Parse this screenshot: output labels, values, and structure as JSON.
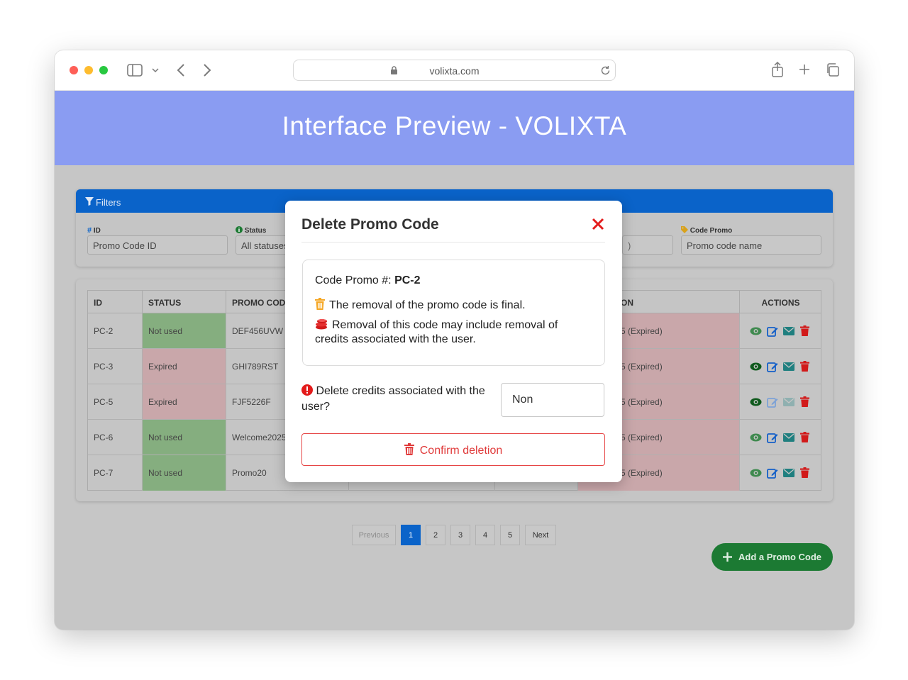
{
  "browser": {
    "url": "volixta.com"
  },
  "app": {
    "title": "Interface Preview - VOLIXTA"
  },
  "filters": {
    "title": "Filters",
    "id_label": "ID",
    "id_placeholder": "Promo Code ID",
    "status_label": "Status",
    "status_value": "All statuses",
    "code_label": "Code Promo",
    "code_placeholder": "Promo code name"
  },
  "table": {
    "headers": {
      "id": "ID",
      "status": "STATUS",
      "promo": "PROMO CODE",
      "expiration_partial": "ON",
      "actions": "ACTIONS"
    },
    "rows": [
      {
        "id": "PC-2",
        "status": "Not used",
        "status_color": "green",
        "code": "DEF456UVW",
        "expiry": "5 (Expired)",
        "view_active": false,
        "edit_active": true,
        "mail_active": true
      },
      {
        "id": "PC-3",
        "status": "Expired",
        "status_color": "red",
        "code": "GHI789RST",
        "expiry": "5 (Expired)",
        "view_active": true,
        "edit_active": true,
        "mail_active": true
      },
      {
        "id": "PC-5",
        "status": "Expired",
        "status_color": "red",
        "code": "FJF5226F",
        "expiry": "5 (Expired)",
        "view_active": true,
        "edit_active": false,
        "mail_active": false
      },
      {
        "id": "PC-6",
        "status": "Not used",
        "status_color": "green",
        "code": "Welcome2025",
        "expiry": "5 (Expired)",
        "view_active": false,
        "edit_active": true,
        "mail_active": true
      },
      {
        "id": "PC-7",
        "status": "Not used",
        "status_color": "green",
        "code": "Promo20",
        "expiry": "5 (Expired)",
        "view_active": false,
        "edit_active": true,
        "mail_active": true
      }
    ]
  },
  "pagination": {
    "previous": "Previous",
    "pages": [
      "1",
      "2",
      "3",
      "4",
      "5"
    ],
    "next": "Next",
    "active_page": "1"
  },
  "add_button": {
    "label": "Add a Promo Code"
  },
  "modal": {
    "title": "Delete Promo Code",
    "code_prefix": "Code Promo #: ",
    "code_value": "PC-2",
    "line1": "The removal of the promo code is final.",
    "line2a": "Removal of this code may include removal of",
    "line2b": "credits associated with the user.",
    "question": "Delete credits associated with the user?",
    "select_value": "Non",
    "confirm_label": "Confirm deletion"
  },
  "colors": {
    "header_bg": "#8a9cf2",
    "primary": "#0a63c9",
    "danger": "#e03b3b",
    "success": "#1c7a33",
    "warning": "#f5a623"
  }
}
